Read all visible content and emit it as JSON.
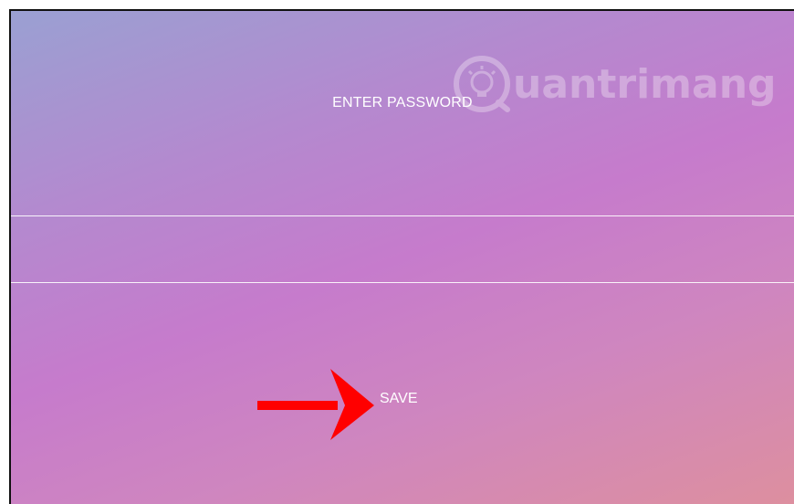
{
  "form": {
    "title": "ENTER PASSWORD",
    "password_value": "",
    "save_label": "SAVE"
  },
  "watermark": {
    "text": "uantrimang",
    "icon": "lightbulb-icon"
  },
  "annotation": {
    "arrow_icon": "arrow-right-icon",
    "arrow_color": "#ff0000"
  },
  "colors": {
    "gradient_start": "#9aa0d2",
    "gradient_mid": "#c67bcc",
    "gradient_end": "#dd8f9f",
    "text": "#ffffff"
  }
}
